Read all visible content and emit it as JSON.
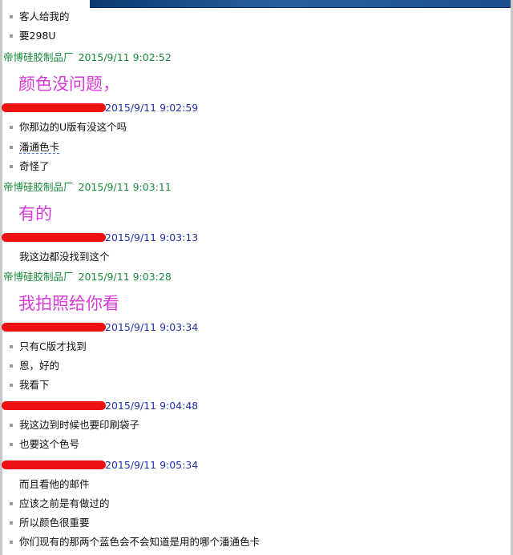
{
  "conversation": [
    {
      "type": "msg",
      "text": "客人给我的",
      "bullet": true
    },
    {
      "type": "msg",
      "text": "要298U",
      "bullet": true
    },
    {
      "type": "header",
      "side": "mine",
      "sender": "帝博硅胶制品厂",
      "time": "2015/9/11 9:02:52"
    },
    {
      "type": "big",
      "text": "颜色没问题，"
    },
    {
      "type": "header",
      "side": "other",
      "sender": "",
      "time": "2015/9/11 9:02:59"
    },
    {
      "type": "msg",
      "text": "你那边的U版有没这个吗",
      "bullet": true
    },
    {
      "type": "msg",
      "text": "潘通色卡",
      "bullet": true,
      "underline": true
    },
    {
      "type": "msg",
      "text": "奇怪了",
      "bullet": true
    },
    {
      "type": "header",
      "side": "mine",
      "sender": "帝博硅胶制品厂",
      "time": "2015/9/11 9:03:11"
    },
    {
      "type": "big",
      "text": "有的"
    },
    {
      "type": "header",
      "side": "other",
      "sender": "",
      "time": "2015/9/11 9:03:13"
    },
    {
      "type": "msg",
      "text": "我这边都没找到这个",
      "bullet": false
    },
    {
      "type": "header",
      "side": "mine",
      "sender": "帝博硅胶制品厂",
      "time": "2015/9/11 9:03:28"
    },
    {
      "type": "big",
      "text": "我拍照给你看"
    },
    {
      "type": "header",
      "side": "other",
      "sender": "",
      "time": "2015/9/11 9:03:34"
    },
    {
      "type": "msg",
      "text": "只有C版才找到",
      "bullet": true
    },
    {
      "type": "msg",
      "text": "恩，好的",
      "bullet": true
    },
    {
      "type": "msg",
      "text": "我看下",
      "bullet": true
    },
    {
      "type": "header",
      "side": "other",
      "sender": "",
      "time": "2015/9/11 9:04:48"
    },
    {
      "type": "msg",
      "text": "我这边到时候也要印刷袋子",
      "bullet": true
    },
    {
      "type": "msg",
      "text": "也要这个色号",
      "bullet": true
    },
    {
      "type": "header",
      "side": "other",
      "sender": "",
      "time": "2015/9/11 9:05:34"
    },
    {
      "type": "msg",
      "text": "而且看他的邮件",
      "bullet": false
    },
    {
      "type": "msg",
      "text": "应该之前是有做过的",
      "bullet": true
    },
    {
      "type": "msg",
      "text": "所以颜色很重要",
      "bullet": true
    },
    {
      "type": "msg",
      "text": "你们现有的那两个蓝色会不会知道是用的哪个潘通色卡",
      "bullet": true
    }
  ],
  "colors": {
    "mine_header": "#178a3a",
    "other_header": "#2233aa",
    "big_text": "#d83ad8",
    "redaction": "#ee1111"
  }
}
